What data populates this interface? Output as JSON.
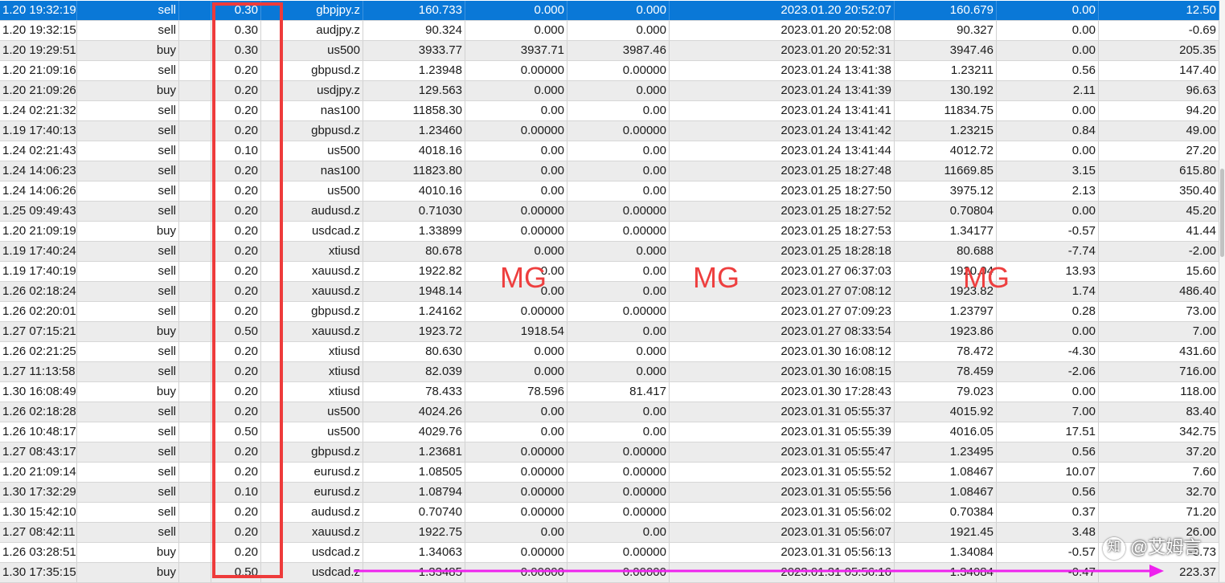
{
  "rows": [
    [
      "1.20 19:32:19",
      "sell",
      "0.30",
      "gbpjpy.z",
      "160.733",
      "0.000",
      "0.000",
      "2023.01.20 20:52:07",
      "160.679",
      "0.00",
      "12.50"
    ],
    [
      "1.20 19:32:15",
      "sell",
      "0.30",
      "audjpy.z",
      "90.324",
      "0.000",
      "0.000",
      "2023.01.20 20:52:08",
      "90.327",
      "0.00",
      "-0.69"
    ],
    [
      "1.20 19:29:51",
      "buy",
      "0.30",
      "us500",
      "3933.77",
      "3937.71",
      "3987.46",
      "2023.01.20 20:52:31",
      "3947.46",
      "0.00",
      "205.35"
    ],
    [
      "1.20 21:09:16",
      "sell",
      "0.20",
      "gbpusd.z",
      "1.23948",
      "0.00000",
      "0.00000",
      "2023.01.24 13:41:38",
      "1.23211",
      "0.56",
      "147.40"
    ],
    [
      "1.20 21:09:26",
      "buy",
      "0.20",
      "usdjpy.z",
      "129.563",
      "0.000",
      "0.000",
      "2023.01.24 13:41:39",
      "130.192",
      "2.11",
      "96.63"
    ],
    [
      "1.24 02:21:32",
      "sell",
      "0.20",
      "nas100",
      "11858.30",
      "0.00",
      "0.00",
      "2023.01.24 13:41:41",
      "11834.75",
      "0.00",
      "94.20"
    ],
    [
      "1.19 17:40:13",
      "sell",
      "0.20",
      "gbpusd.z",
      "1.23460",
      "0.00000",
      "0.00000",
      "2023.01.24 13:41:42",
      "1.23215",
      "0.84",
      "49.00"
    ],
    [
      "1.24 02:21:43",
      "sell",
      "0.10",
      "us500",
      "4018.16",
      "0.00",
      "0.00",
      "2023.01.24 13:41:44",
      "4012.72",
      "0.00",
      "27.20"
    ],
    [
      "1.24 14:06:23",
      "sell",
      "0.20",
      "nas100",
      "11823.80",
      "0.00",
      "0.00",
      "2023.01.25 18:27:48",
      "11669.85",
      "3.15",
      "615.80"
    ],
    [
      "1.24 14:06:26",
      "sell",
      "0.20",
      "us500",
      "4010.16",
      "0.00",
      "0.00",
      "2023.01.25 18:27:50",
      "3975.12",
      "2.13",
      "350.40"
    ],
    [
      "1.25 09:49:43",
      "sell",
      "0.20",
      "audusd.z",
      "0.71030",
      "0.00000",
      "0.00000",
      "2023.01.25 18:27:52",
      "0.70804",
      "0.00",
      "45.20"
    ],
    [
      "1.20 21:09:19",
      "buy",
      "0.20",
      "usdcad.z",
      "1.33899",
      "0.00000",
      "0.00000",
      "2023.01.25 18:27:53",
      "1.34177",
      "-0.57",
      "41.44"
    ],
    [
      "1.19 17:40:24",
      "sell",
      "0.20",
      "xtiusd",
      "80.678",
      "0.000",
      "0.000",
      "2023.01.25 18:28:18",
      "80.688",
      "-7.74",
      "-2.00"
    ],
    [
      "1.19 17:40:19",
      "sell",
      "0.20",
      "xauusd.z",
      "1922.82",
      "0.00",
      "0.00",
      "2023.01.27 06:37:03",
      "1920.04",
      "13.93",
      "15.60"
    ],
    [
      "1.26 02:18:24",
      "sell",
      "0.20",
      "xauusd.z",
      "1948.14",
      "0.00",
      "0.00",
      "2023.01.27 07:08:12",
      "1923.82",
      "1.74",
      "486.40"
    ],
    [
      "1.26 02:20:01",
      "sell",
      "0.20",
      "gbpusd.z",
      "1.24162",
      "0.00000",
      "0.00000",
      "2023.01.27 07:09:23",
      "1.23797",
      "0.28",
      "73.00"
    ],
    [
      "1.27 07:15:21",
      "buy",
      "0.50",
      "xauusd.z",
      "1923.72",
      "1918.54",
      "0.00",
      "2023.01.27 08:33:54",
      "1923.86",
      "0.00",
      "7.00"
    ],
    [
      "1.26 02:21:25",
      "sell",
      "0.20",
      "xtiusd",
      "80.630",
      "0.000",
      "0.000",
      "2023.01.30 16:08:12",
      "78.472",
      "-4.30",
      "431.60"
    ],
    [
      "1.27 11:13:58",
      "sell",
      "0.20",
      "xtiusd",
      "82.039",
      "0.000",
      "0.000",
      "2023.01.30 16:08:15",
      "78.459",
      "-2.06",
      "716.00"
    ],
    [
      "1.30 16:08:49",
      "buy",
      "0.20",
      "xtiusd",
      "78.433",
      "78.596",
      "81.417",
      "2023.01.30 17:28:43",
      "79.023",
      "0.00",
      "118.00"
    ],
    [
      "1.26 02:18:28",
      "sell",
      "0.20",
      "us500",
      "4024.26",
      "0.00",
      "0.00",
      "2023.01.31 05:55:37",
      "4015.92",
      "7.00",
      "83.40"
    ],
    [
      "1.26 10:48:17",
      "sell",
      "0.50",
      "us500",
      "4029.76",
      "0.00",
      "0.00",
      "2023.01.31 05:55:39",
      "4016.05",
      "17.51",
      "342.75"
    ],
    [
      "1.27 08:43:17",
      "sell",
      "0.20",
      "gbpusd.z",
      "1.23681",
      "0.00000",
      "0.00000",
      "2023.01.31 05:55:47",
      "1.23495",
      "0.56",
      "37.20"
    ],
    [
      "1.20 21:09:14",
      "sell",
      "0.20",
      "eurusd.z",
      "1.08505",
      "0.00000",
      "0.00000",
      "2023.01.31 05:55:52",
      "1.08467",
      "10.07",
      "7.60"
    ],
    [
      "1.30 17:32:29",
      "sell",
      "0.10",
      "eurusd.z",
      "1.08794",
      "0.00000",
      "0.00000",
      "2023.01.31 05:55:56",
      "1.08467",
      "0.56",
      "32.70"
    ],
    [
      "1.30 15:42:10",
      "sell",
      "0.20",
      "audusd.z",
      "0.70740",
      "0.00000",
      "0.00000",
      "2023.01.31 05:56:02",
      "0.70384",
      "0.37",
      "71.20"
    ],
    [
      "1.27 08:42:11",
      "sell",
      "0.20",
      "xauusd.z",
      "1922.75",
      "0.00",
      "0.00",
      "2023.01.31 05:56:07",
      "1921.45",
      "3.48",
      "26.00"
    ],
    [
      "1.26 03:28:51",
      "buy",
      "0.20",
      "usdcad.z",
      "1.34063",
      "0.00000",
      "0.00000",
      "2023.01.31 05:56:13",
      "1.34084",
      "-0.57",
      "-3.73"
    ],
    [
      "1.30 17:35:15",
      "buy",
      "0.50",
      "usdcad.z",
      "1.33485",
      "0.00000",
      "0.00000",
      "2023.01.31 05:56:16",
      "1.34084",
      "-0.47",
      "223.37"
    ]
  ],
  "selected_row": 0,
  "overlays": {
    "mg_1": "MG",
    "mg_2": "MG",
    "mg_3": "MG",
    "watermark": "@艾姆言"
  },
  "colors": {
    "selection": "#0a78d7",
    "annotation_red": "#ee3b3b",
    "arrow_magenta": "#ee22ee"
  },
  "icons": {
    "watermark_logo": "zhihu-logo-icon"
  }
}
